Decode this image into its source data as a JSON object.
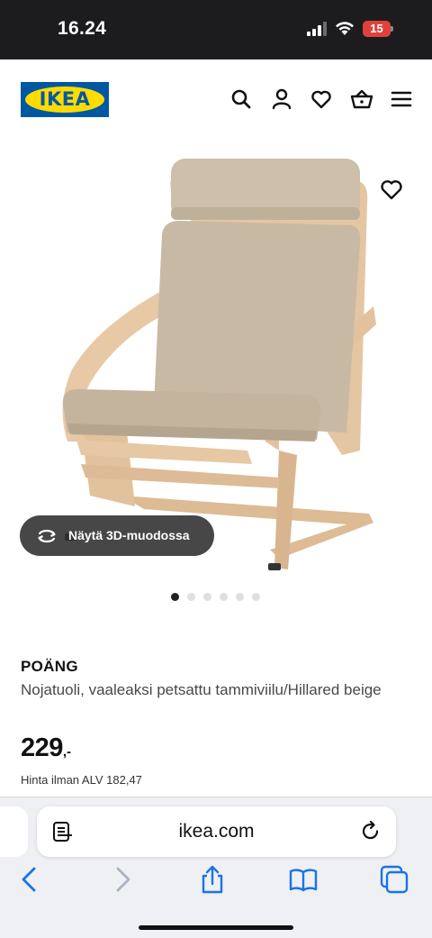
{
  "status_bar": {
    "time": "16.24",
    "battery_level": "15",
    "battery_color": "#e0423a"
  },
  "header": {
    "logo_text": "IKEA",
    "brand_blue": "#0058a3",
    "brand_yellow": "#ffdb00",
    "icons": [
      "search-icon",
      "user-icon",
      "heart-icon",
      "shopping-bag-icon",
      "menu-icon"
    ]
  },
  "gallery": {
    "favourite_icon": "heart-outline-icon",
    "view_3d_label": "Näytä 3D-muodossa",
    "view_3d_icon": "rotate-3d-icon",
    "image_count": 6,
    "active_image_index": 0
  },
  "product": {
    "name": "POÄNG",
    "description": "Nojatuoli, vaaleaksi petsattu tammiviilu/Hillared beige",
    "price_integer": "229",
    "price_suffix": ",-",
    "vat_note": "Hinta ilman ALV 182,47"
  },
  "browser": {
    "url": "ikea.com",
    "icons": [
      "reader-mode-icon",
      "reload-icon",
      "back-icon",
      "forward-icon",
      "share-icon",
      "bookmarks-icon",
      "tabs-icon"
    ]
  }
}
